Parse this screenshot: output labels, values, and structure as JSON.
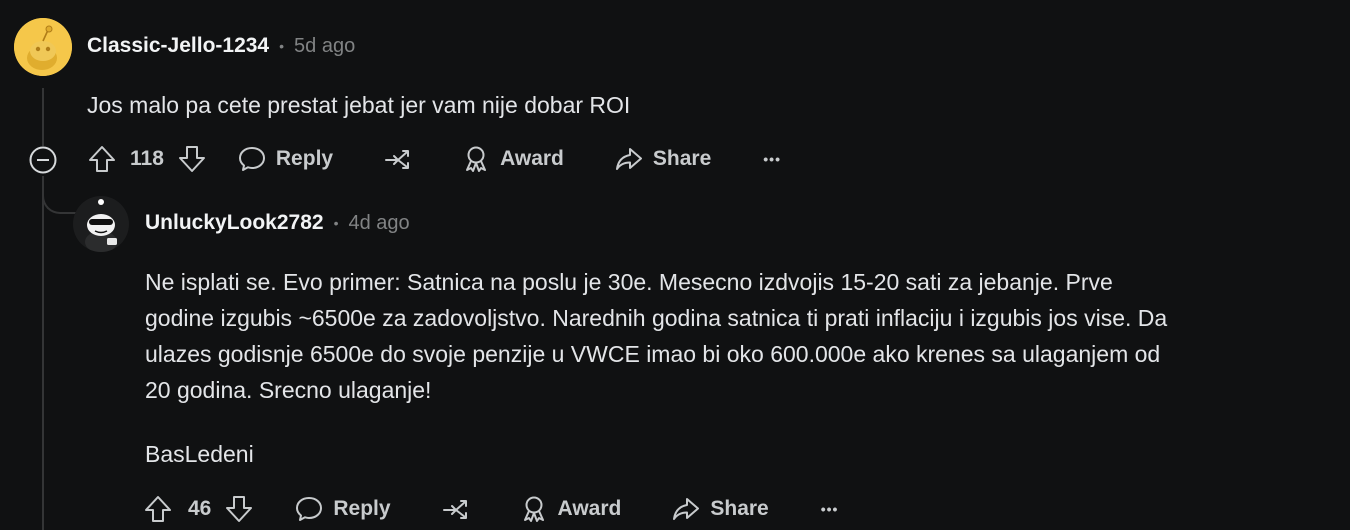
{
  "comment": {
    "author": "Classic-Jello-1234",
    "age": "5d ago",
    "text": "Jos malo pa cete prestat jebat jer vam nije dobar ROI",
    "score": "118",
    "actions": {
      "reply": "Reply",
      "award": "Award",
      "share": "Share",
      "more": "•••"
    }
  },
  "reply": {
    "author": "UnluckyLook2782",
    "age": "4d ago",
    "lines": [
      "Ne isplati se. Evo primer: Satnica na poslu je 30e. Mesecno izdvojis 15-20 sati za jebanje. Prve",
      "godine izgubis ~6500e za zadovoljstvo. Narednih godina satnica ti prati inflaciju i izgubis jos vise. Da",
      "ulazes godisnje 6500e do svoje penzije u VWCE imao bi oko 600.000e ako krenes sa ulaganjem od",
      "20 godina. Srecno ulaganje!"
    ],
    "signature": "BasLedeni",
    "score": "46",
    "actions": {
      "reply": "Reply",
      "award": "Award",
      "share": "Share",
      "more": "•••"
    }
  },
  "separator": "•",
  "colors": {
    "background": "#101112",
    "text": "#e3e5e8",
    "muted": "#818384",
    "avatar_yellow": "#f5c74a"
  }
}
